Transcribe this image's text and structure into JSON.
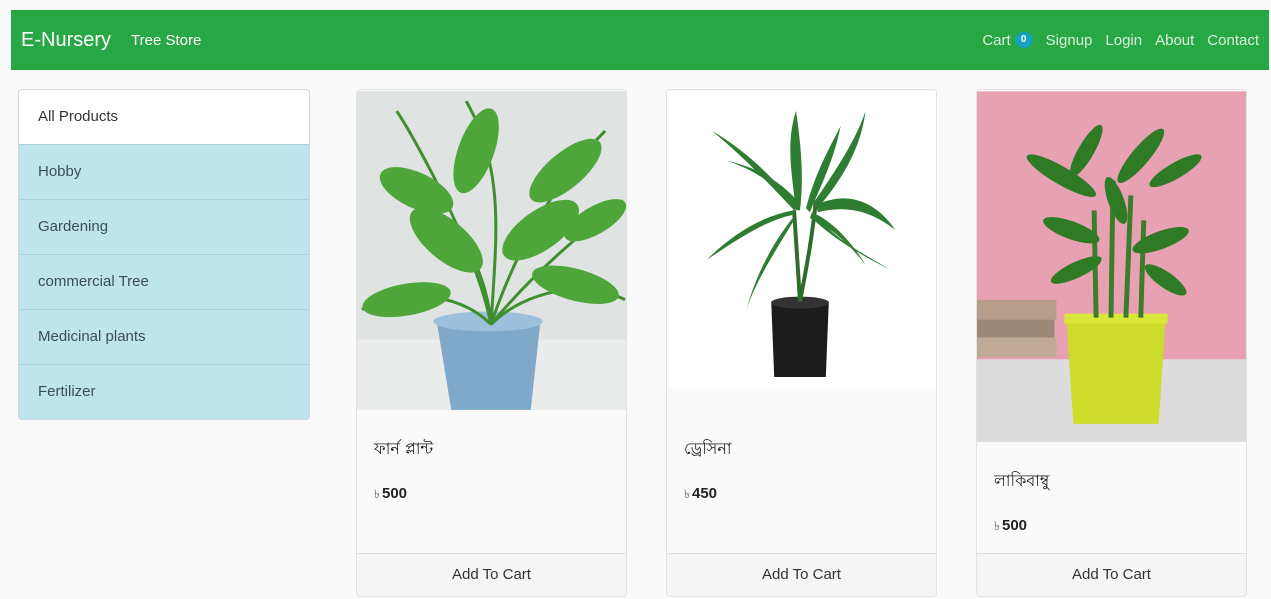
{
  "navbar": {
    "brand": "E-Nursery",
    "store": "Tree Store",
    "cart_label": "Cart",
    "cart_count": "0",
    "links": [
      "Signup",
      "Login",
      "About",
      "Contact"
    ]
  },
  "sidebar": {
    "items": [
      "All Products",
      "Hobby",
      "Gardening",
      "commercial Tree",
      "Medicinal plants",
      "Fertilizer"
    ]
  },
  "products": [
    {
      "name": "ফার্ন প্লান্ট",
      "currency": "৳",
      "price": "500",
      "button": "Add To Cart"
    },
    {
      "name": "ড্রেসিনা",
      "currency": "৳",
      "price": "450",
      "button": "Add To Cart"
    },
    {
      "name": "লাকিবাম্বু",
      "currency": "৳",
      "price": "500",
      "button": "Add To Cart"
    }
  ],
  "colors": {
    "navbar": "#28a745",
    "sidebar_item": "#bee5eb",
    "badge": "#17a2b8"
  }
}
